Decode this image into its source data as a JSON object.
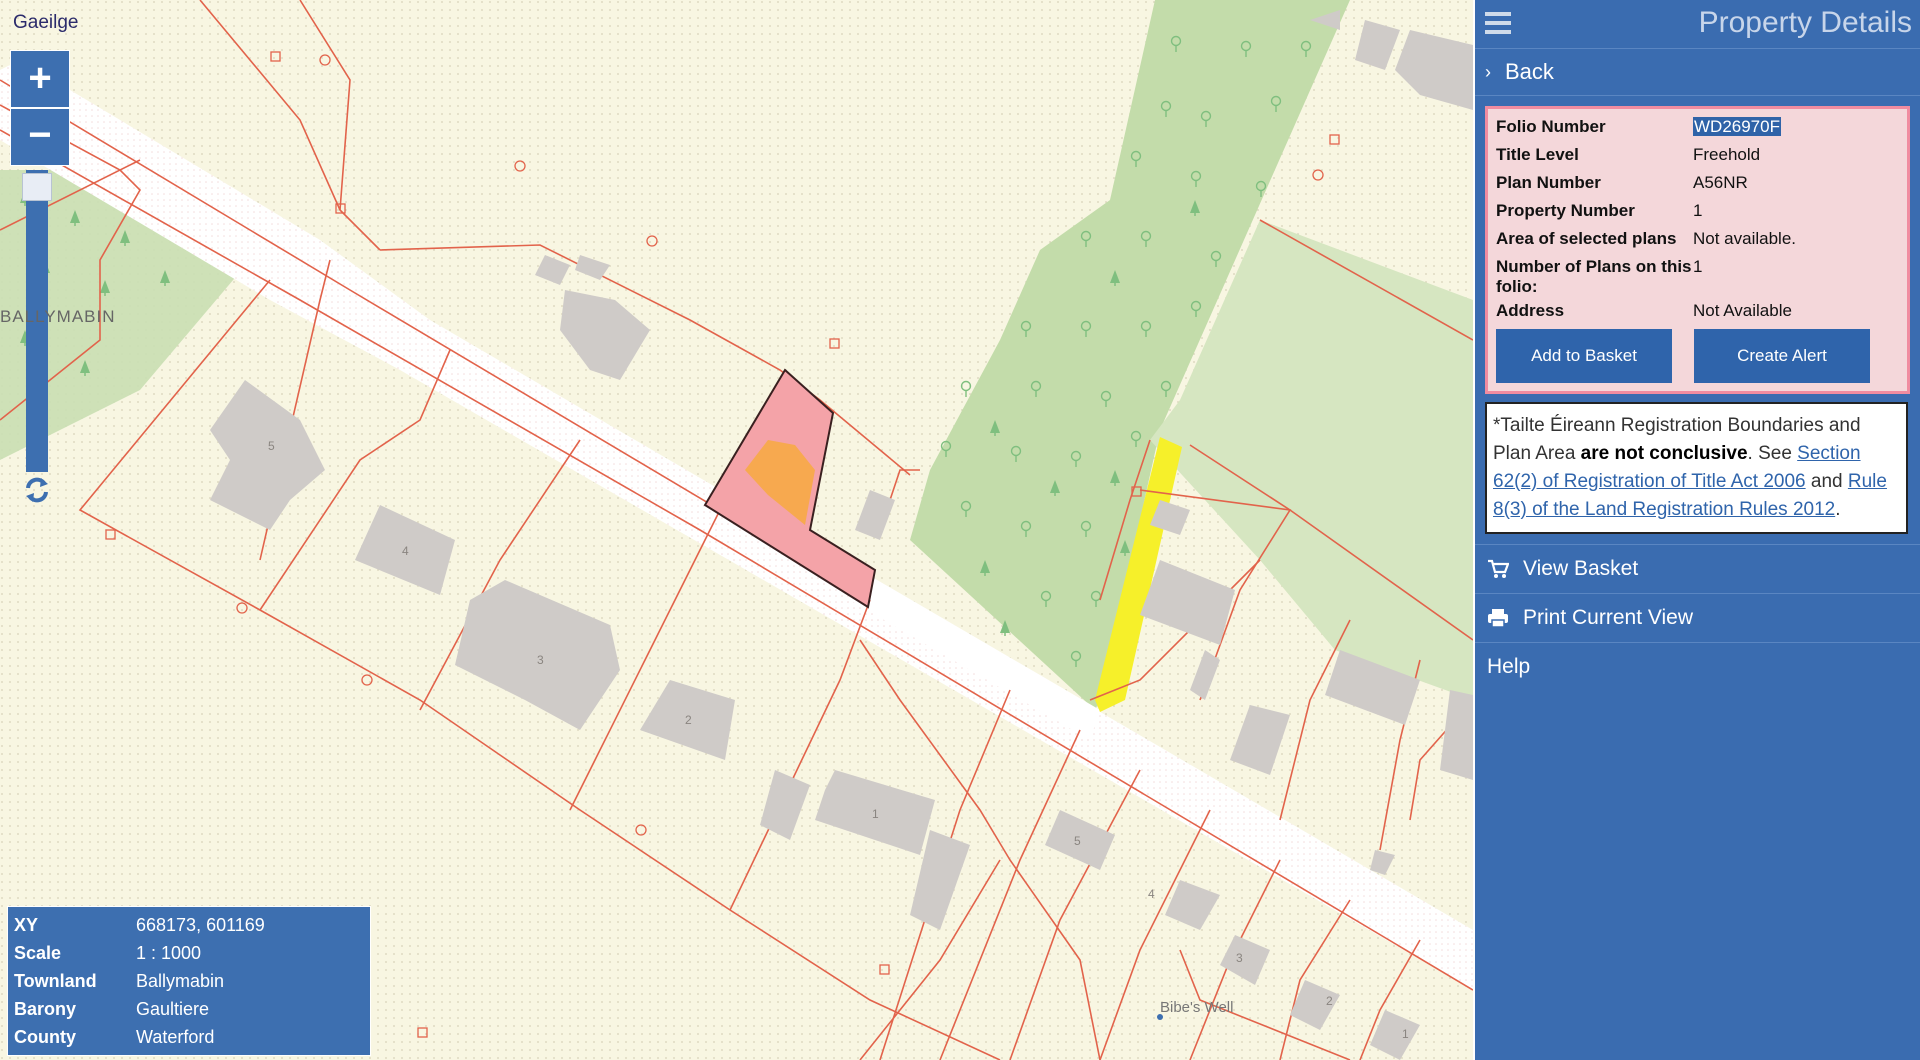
{
  "map": {
    "language_link": "Gaeilge",
    "zoom_in_label": "+",
    "zoom_out_label": "−",
    "townland_label": "BALLYMABIN",
    "place_label": "Bibe's Well",
    "house_numbers_top": [
      "5",
      "4",
      "3",
      "2",
      "1"
    ],
    "house_numbers_bottom": [
      "5",
      "4",
      "3",
      "2",
      "1"
    ]
  },
  "infobox": {
    "rows": [
      {
        "key": "XY",
        "value": "668173, 601169"
      },
      {
        "key": "Scale",
        "value": "1 : 1000"
      },
      {
        "key": "Townland",
        "value": "Ballymabin"
      },
      {
        "key": "Barony",
        "value": "Gaultiere"
      },
      {
        "key": "County",
        "value": "Waterford"
      }
    ]
  },
  "panel": {
    "title": "Property Details",
    "back_label": "Back",
    "details": [
      {
        "key": "Folio Number",
        "value": "WD26970F"
      },
      {
        "key": "Title Level",
        "value": "Freehold"
      },
      {
        "key": "Plan Number",
        "value": "A56NR"
      },
      {
        "key": "Property Number",
        "value": "1"
      },
      {
        "key": "Area of selected plans",
        "value": "Not available."
      },
      {
        "key": "Number of Plans on this folio:",
        "value": "1"
      },
      {
        "key": "Address",
        "value": "Not Available"
      }
    ],
    "add_to_basket": "Add to Basket",
    "create_alert": "Create Alert",
    "notice": {
      "intro": "*Tailte Éireann Registration Boundaries and Plan Area ",
      "bold": "are not conclusive",
      "mid": ". See ",
      "link1": "Section 62(2) of Registration of Title Act 2006",
      "and": " and ",
      "link2": "Rule 8(3) of the Land Registration Rules 2012",
      "end": "."
    },
    "view_basket": "View Basket",
    "print_view": "Print Current View",
    "help": "Help"
  },
  "colors": {
    "panel_blue": "#3a6cb0",
    "selected_parcel": "#f4a3a8",
    "building_orange": "#f7a94f",
    "yellow_strip": "#f6f02a",
    "boundary_red": "#e2634b"
  }
}
